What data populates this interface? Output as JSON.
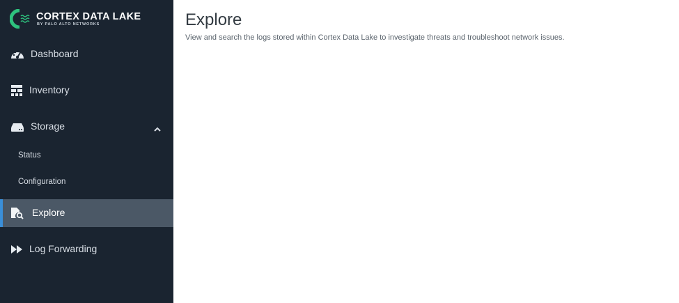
{
  "app": {
    "logo_title": "CORTEX DATA LAKE",
    "logo_subtitle": "BY PALO ALTO NETWORKS"
  },
  "colors": {
    "sidebar_bg": "#1a2430",
    "active_bg": "#4b5866",
    "accent": "#3a8fd9",
    "logo_green": "#2ec27e"
  },
  "sidebar": {
    "items": [
      {
        "label": "Dashboard",
        "icon": "dashboard-gauge-icon"
      },
      {
        "label": "Inventory",
        "icon": "inventory-grid-icon"
      },
      {
        "label": "Storage",
        "icon": "storage-drive-icon",
        "expanded": true,
        "children": [
          {
            "label": "Status"
          },
          {
            "label": "Configuration"
          }
        ]
      },
      {
        "label": "Explore",
        "icon": "explore-file-search-icon",
        "active": true
      },
      {
        "label": "Log Forwarding",
        "icon": "fast-forward-icon"
      }
    ]
  },
  "main": {
    "title": "Explore",
    "description": "View and search the logs stored within Cortex Data Lake to investigate threats and troubleshoot network issues."
  }
}
